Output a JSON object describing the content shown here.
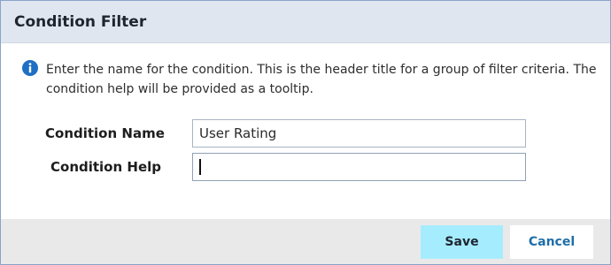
{
  "dialog": {
    "title": "Condition Filter",
    "info_icon": "info-circle-icon",
    "info_text": "Enter the name for the condition. This is the header title for a group of filter criteria. The condition help will be provided as a tooltip."
  },
  "form": {
    "condition_name_label": "Condition Name",
    "condition_name_value": "User Rating",
    "condition_help_label": "Condition Help",
    "condition_help_value": ""
  },
  "footer": {
    "save_label": "Save",
    "cancel_label": "Cancel"
  },
  "colors": {
    "header_bg": "#dfe6f0",
    "info_icon": "#1f6fc5",
    "save_bg": "#a6ecff",
    "cancel_text": "#1e6fa8"
  }
}
